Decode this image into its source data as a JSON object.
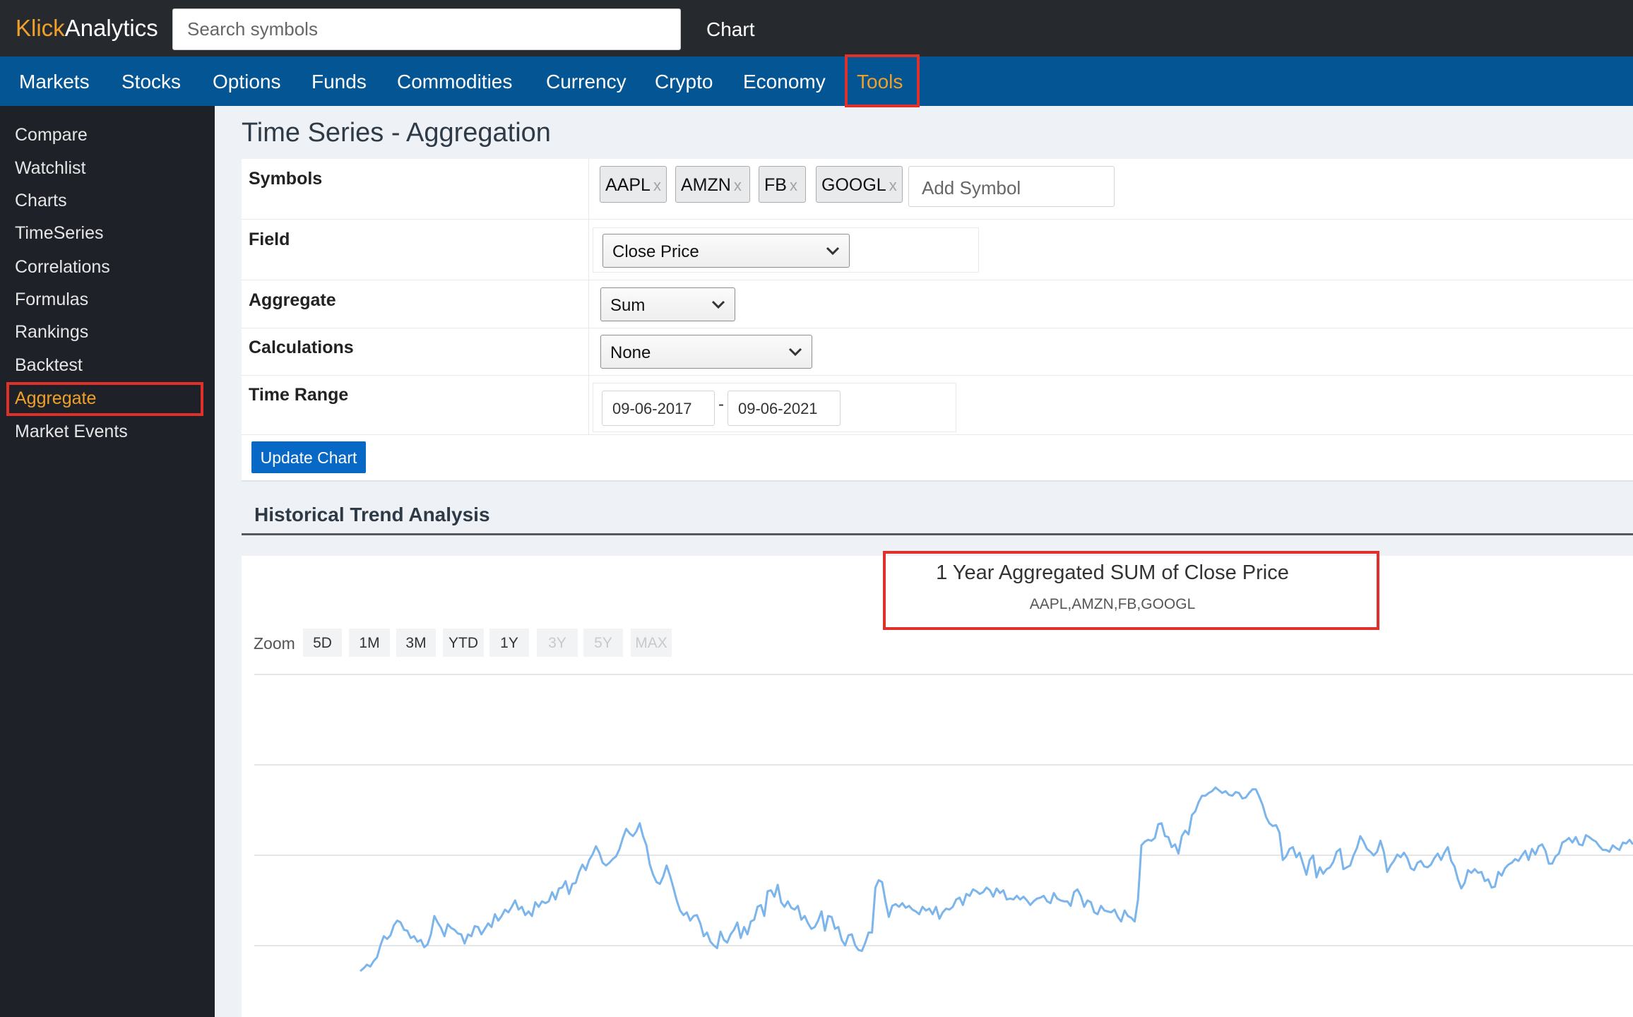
{
  "logo": {
    "part1": "Klick",
    "part2": "Analytics"
  },
  "search": {
    "placeholder": "Search symbols"
  },
  "top_chart_label": "Chart",
  "nav": [
    "Markets",
    "Stocks",
    "Options",
    "Funds",
    "Commodities",
    "Currency",
    "Crypto",
    "Economy",
    "Tools"
  ],
  "nav_active": "Tools",
  "sidebar": [
    "Compare",
    "Watchlist",
    "Charts",
    "TimeSeries",
    "Correlations",
    "Formulas",
    "Rankings",
    "Backtest",
    "Aggregate",
    "Market Events"
  ],
  "sidebar_active": "Aggregate",
  "page_title": "Time Series - Aggregation",
  "form": {
    "symbols_label": "Symbols",
    "symbols": [
      "AAPL",
      "AMZN",
      "FB",
      "GOOGL"
    ],
    "chip_remove": "x",
    "add_symbol_placeholder": "Add Symbol",
    "field_label": "Field",
    "field_value": "Close Price",
    "aggregate_label": "Aggregate",
    "aggregate_value": "Sum",
    "calculations_label": "Calculations",
    "calculations_value": "None",
    "time_range_label": "Time Range",
    "date_start": "09-06-2017",
    "date_separator": "-",
    "date_end": "09-06-2021",
    "update_button": "Update Chart"
  },
  "section_title": "Historical Trend Analysis",
  "colors": {
    "accent": "#f0a028",
    "nav_bg": "#045593",
    "top_bg": "#26292e",
    "sidebar_bg": "#1e2128",
    "button": "#0868c5",
    "line": "#7cb5ec",
    "highlight": "#e0302a"
  },
  "chart_data": {
    "type": "line",
    "title": "1 Year Aggregated SUM of Close Price",
    "subtitle": "AAPL,AMZN,FB,GOOGL",
    "zoom_label": "Zoom",
    "zoom_buttons": [
      "5D",
      "1M",
      "3M",
      "YTD",
      "1Y",
      "3Y",
      "5Y",
      "MAX"
    ],
    "zoom_disabled": [
      "3Y",
      "5Y",
      "MAX"
    ],
    "grid": true,
    "series": [
      {
        "values": [
          50,
          53,
          57,
          55,
          61,
          65,
          78,
          88,
          85,
          89,
          100,
          105,
          103,
          95,
          94,
          86,
          88,
          82,
          84,
          76,
          79,
          90,
          110,
          103,
          97,
          88,
          101,
          97,
          95,
          91,
          90,
          80,
          90,
          88,
          99,
          98,
          90,
          96,
          102,
          98,
          112,
          105,
          110,
          117,
          114,
          120,
          127,
          117,
          120,
          111,
          115,
          110,
          125,
          120,
          126,
          124,
          126,
          136,
          128,
          140,
          141,
          148,
          134,
          145,
          146,
          158,
          166,
          160,
          171,
          177,
          186,
          179,
          168,
          165,
          168,
          172,
          175,
          183,
          195,
          205,
          200,
          197,
          202,
          211,
          197,
          187,
          166,
          155,
          147,
          145,
          153,
          165,
          154,
          141,
          127,
          116,
          111,
          114,
          105,
          110,
          111,
          102,
          88,
          92,
          82,
          78,
          75,
          93,
          84,
          81,
          90,
          95,
          103,
          86,
          98,
          90,
          104,
          106,
          120,
          122,
          110,
          137,
          138,
          131,
          144,
          125,
          120,
          126,
          119,
          117,
          121,
          106,
          110,
          102,
          96,
          98,
          105,
          115,
          94,
          110,
          109,
          96,
          98,
          84,
          78,
          89,
          90,
          78,
          73,
          72,
          81,
          92,
          92,
          141,
          149,
          147,
          126,
          109,
          121,
          123,
          120,
          124,
          119,
          121,
          117,
          115,
          112,
          120,
          116,
          118,
          112,
          120,
          107,
          114,
          118,
          117,
          120,
          128,
          130,
          122,
          134,
          132,
          139,
          137,
          134,
          136,
          141,
          138,
          131,
          140,
          135,
          138,
          128,
          129,
          128,
          132,
          128,
          131,
          127,
          122,
          126,
          129,
          130,
          132,
          126,
          124,
          135,
          129,
          127,
          126,
          126,
          121,
          136,
          139,
          132,
          120,
          127,
          125,
          114,
          112,
          121,
          116,
          115,
          114,
          117,
          109,
          104,
          116,
          110,
          108,
          104,
          128,
          187,
          191,
          193,
          192,
          195,
          210,
          211,
          197,
          196,
          185,
          188,
          178,
          197,
          203,
          199,
          220,
          224,
          234,
          241,
          241,
          244,
          246,
          250,
          247,
          244,
          246,
          242,
          241,
          245,
          244,
          238,
          239,
          244,
          248,
          248,
          240,
          231,
          218,
          211,
          208,
          209,
          201,
          171,
          175,
          183,
          185,
          174,
          179,
          167,
          155,
          171,
          176,
          152,
          163,
          156,
          161,
          163,
          169,
          180,
          183,
          161,
          163,
          165,
          176,
          184,
          197,
          191,
          183,
          180,
          176,
          180,
          192,
          180,
          158,
          165,
          170,
          177,
          174,
          179,
          173,
          162,
          160,
          168,
          170,
          164,
          163,
          166,
          173,
          178,
          171,
          179,
          185,
          170,
          164,
          150,
          140,
          146,
          160,
          157,
          161,
          157,
          158,
          148,
          150,
          141,
          142,
          158,
          154,
          162,
          166,
          168,
          172,
          170,
          176,
          181,
          171,
          183,
          177,
          186,
          188,
          181,
          167,
          167,
          175,
          178,
          190,
          192,
          195,
          190,
          196,
          188,
          187,
          198,
          196,
          193,
          191,
          186,
          182,
          182,
          180,
          187,
          184,
          182,
          190,
          189,
          193,
          188
        ]
      }
    ]
  }
}
